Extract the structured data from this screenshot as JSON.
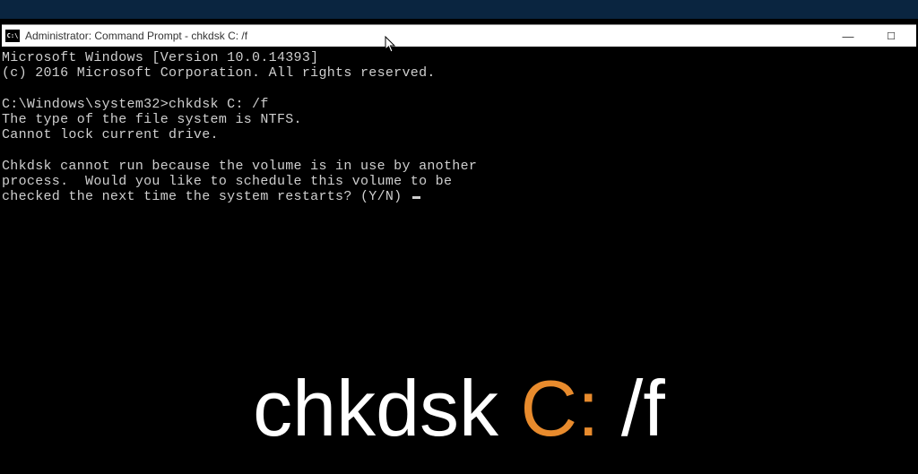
{
  "titlebar": {
    "icon_glyph": "C:\\",
    "text": "Administrator: Command Prompt - chkdsk  C: /f"
  },
  "controls": {
    "minimize": "—",
    "maximize": "☐",
    "close": "✕"
  },
  "terminal": {
    "line1": "Microsoft Windows [Version 10.0.14393]",
    "line2": "(c) 2016 Microsoft Corporation. All rights reserved.",
    "blank1": "",
    "line3": "C:\\Windows\\system32>chkdsk C: /f",
    "line4": "The type of the file system is NTFS.",
    "line5": "Cannot lock current drive.",
    "blank2": "",
    "line6": "Chkdsk cannot run because the volume is in use by another",
    "line7": "process.  Would you like to schedule this volume to be",
    "line8": "checked the next time the system restarts? (Y/N) "
  },
  "overlay": {
    "part1": "chkdsk ",
    "part2": "C:",
    "part3": " /f"
  }
}
